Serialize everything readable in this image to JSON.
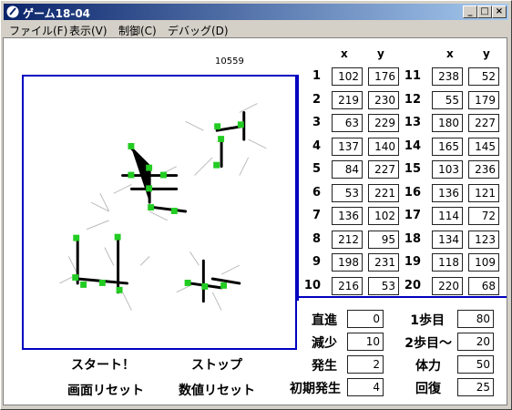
{
  "window": {
    "title": "ゲーム18-04"
  },
  "menu": [
    "ファイル(F)",
    "表示(V)",
    "制御(C)",
    "デバッグ(D)"
  ],
  "counter": "10559",
  "headers": {
    "x": "x",
    "y": "y"
  },
  "points": [
    {
      "n": "1",
      "x": "102",
      "y": "176"
    },
    {
      "n": "2",
      "x": "219",
      "y": "230"
    },
    {
      "n": "3",
      "x": "63",
      "y": "229"
    },
    {
      "n": "4",
      "x": "137",
      "y": "140"
    },
    {
      "n": "5",
      "x": "84",
      "y": "227"
    },
    {
      "n": "6",
      "x": "53",
      "y": "221"
    },
    {
      "n": "7",
      "x": "136",
      "y": "102"
    },
    {
      "n": "8",
      "x": "212",
      "y": "95"
    },
    {
      "n": "9",
      "x": "198",
      "y": "231"
    },
    {
      "n": "10",
      "x": "216",
      "y": "53"
    },
    {
      "n": "11",
      "x": "238",
      "y": "52"
    },
    {
      "n": "12",
      "x": "55",
      "y": "179"
    },
    {
      "n": "13",
      "x": "180",
      "y": "227"
    },
    {
      "n": "14",
      "x": "165",
      "y": "145"
    },
    {
      "n": "15",
      "x": "103",
      "y": "236"
    },
    {
      "n": "16",
      "x": "136",
      "y": "121"
    },
    {
      "n": "17",
      "x": "114",
      "y": "72"
    },
    {
      "n": "18",
      "x": "134",
      "y": "123"
    },
    {
      "n": "19",
      "x": "118",
      "y": "109"
    },
    {
      "n": "20",
      "x": "220",
      "y": "68"
    }
  ],
  "params": {
    "chokushin": {
      "label": "直進",
      "value": "0"
    },
    "genshou": {
      "label": "減少",
      "value": "10"
    },
    "hassei": {
      "label": "発生",
      "value": "2"
    },
    "shoki": {
      "label": "初期発生",
      "value": "4"
    },
    "step1": {
      "label": "1歩目",
      "value": "80"
    },
    "step2": {
      "label": "2歩目～",
      "value": "20"
    },
    "tairyoku": {
      "label": "体力",
      "value": "50"
    },
    "kaifuku": {
      "label": "回復",
      "value": "25"
    }
  },
  "actions": {
    "start": "スタート！",
    "stop": "ストップ",
    "reset_screen": "画面リセット",
    "reset_values": "数値リセット"
  }
}
